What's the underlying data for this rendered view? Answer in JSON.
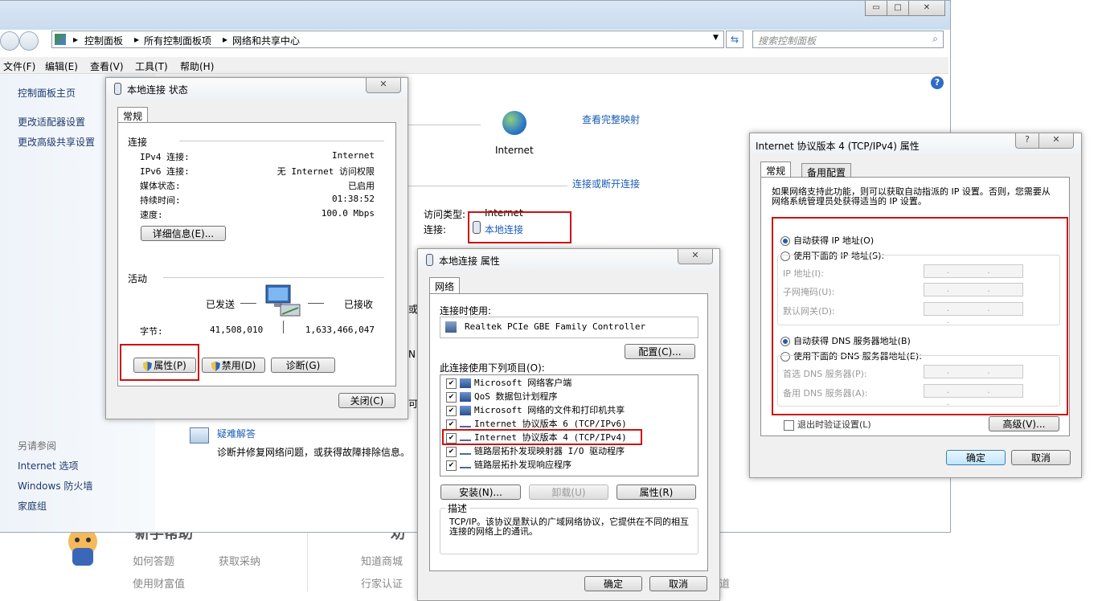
{
  "background_page": {
    "footer_left": {
      "items": [
        "如何答题",
        "获取采纳",
        "使用财富值"
      ]
    },
    "footer_right": {
      "items": [
        "知道商城",
        "行家认证"
      ],
      "partial": "道"
    },
    "footer_heading_fragment": "新手帮助",
    "footer_heading_fragment2": "劝"
  },
  "explorer": {
    "breadcrumb": [
      "控制面板",
      "所有控制面板项",
      "网络和共享中心"
    ],
    "search_placeholder": "搜索控制面板",
    "menu": [
      "文件(F)",
      "编辑(E)",
      "查看(V)",
      "工具(T)",
      "帮助(H)"
    ],
    "sidebar": {
      "main_items": [
        "控制面板主页",
        "更改适配器设置",
        "更改高级共享设置"
      ],
      "see_also_title": "另请参阅",
      "see_also_items": [
        "Internet 选项",
        "Windows 防火墙",
        "家庭组"
      ]
    },
    "internet_label": "Internet",
    "view_full_map": "查看完整映射",
    "connect_disconnect": "连接或断开连接",
    "access_type_label": "访问类型:",
    "access_type_value": "Internet",
    "connection_label": "连接:",
    "connection_value": "本地连接",
    "troubleshoot_title": "疑难解答",
    "troubleshoot_desc": "诊断并修复网络问题，或获得故障排除信息。",
    "cut_chars": [
      "或",
      "N",
      "可"
    ]
  },
  "status_dialog": {
    "title": "本地连接 状态",
    "tab": "常规",
    "connection_section": "连接",
    "rows": [
      {
        "label": "IPv4 连接:",
        "value": "Internet"
      },
      {
        "label": "IPv6 连接:",
        "value": "无 Internet 访问权限"
      },
      {
        "label": "媒体状态:",
        "value": "已启用"
      },
      {
        "label": "持续时间:",
        "value": "01:38:52"
      },
      {
        "label": "速度:",
        "value": "100.0 Mbps"
      }
    ],
    "details_button": "详细信息(E)...",
    "activity_section": "活动",
    "sent_label": "已发送",
    "received_label": "已接收",
    "bytes_label": "字节:",
    "bytes_sent": "41,508,010",
    "bytes_received": "1,633,466,047",
    "properties_button": "属性(P)",
    "disable_button": "禁用(D)",
    "diagnose_button": "诊断(G)",
    "close_button": "关闭(C)"
  },
  "props_dialog": {
    "title": "本地连接 属性",
    "tab": "网络",
    "connect_using_label": "连接时使用:",
    "adapter": "Realtek PCIe GBE Family Controller",
    "configure_button": "配置(C)...",
    "items_label": "此连接使用下列项目(O):",
    "items": [
      "Microsoft 网络客户端",
      "QoS 数据包计划程序",
      "Microsoft 网络的文件和打印机共享",
      "Internet 协议版本 6 (TCP/IPv6)",
      "Internet 协议版本 4 (TCP/IPv4)",
      "链路层拓扑发现映射器 I/O 驱动程序",
      "链路层拓扑发现响应程序"
    ],
    "install_button": "安装(N)...",
    "uninstall_button": "卸载(U)",
    "properties_button": "属性(R)",
    "description_title": "描述",
    "description_text": "TCP/IP。该协议是默认的广域网络协议，它提供在不同的相互连接的网络上的通讯。",
    "ok_button": "确定",
    "cancel_button": "取消"
  },
  "ipv4_dialog": {
    "title": "Internet 协议版本 4 (TCP/IPv4) 属性",
    "help_button": "?",
    "tabs": [
      "常规",
      "备用配置"
    ],
    "intro": "如果网络支持此功能，则可以获取自动指派的 IP 设置。否则，您需要从网络系统管理员处获得适当的 IP 设置。",
    "auto_ip": "自动获得 IP 地址(O)",
    "manual_ip": "使用下面的 IP 地址(S):",
    "ip_fields": [
      "IP 地址(I):",
      "子网掩码(U):",
      "默认网关(D):"
    ],
    "auto_dns": "自动获得 DNS 服务器地址(B)",
    "manual_dns": "使用下面的 DNS 服务器地址(E):",
    "dns_fields": [
      "首选 DNS 服务器(P):",
      "备用 DNS 服务器(A):"
    ],
    "ip_placeholder": ". . .",
    "validate_checkbox": "退出时验证设置(L)",
    "advanced_button": "高级(V)...",
    "ok_button": "确定",
    "cancel_button": "取消"
  },
  "colors": {
    "highlight_red": "#cc1111",
    "link_blue": "#1a5cb5"
  }
}
